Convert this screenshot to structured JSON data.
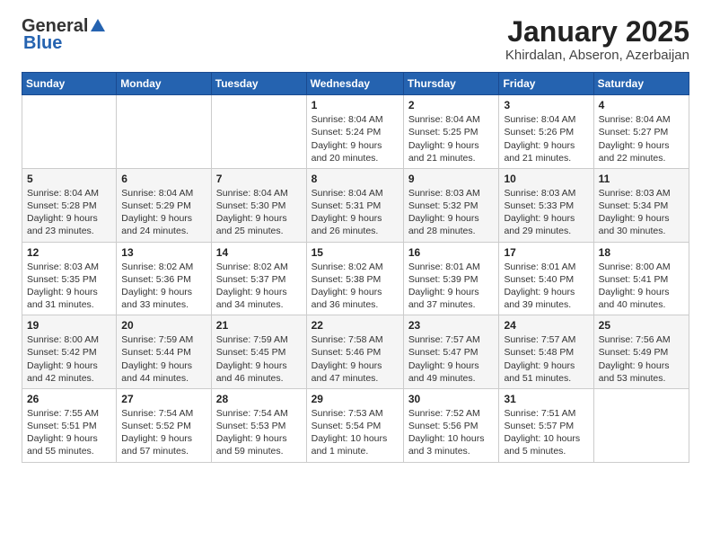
{
  "logo": {
    "line1": "General",
    "line2": "Blue"
  },
  "title": "January 2025",
  "subtitle": "Khirdalan, Abseron, Azerbaijan",
  "days_of_week": [
    "Sunday",
    "Monday",
    "Tuesday",
    "Wednesday",
    "Thursday",
    "Friday",
    "Saturday"
  ],
  "weeks": [
    [
      null,
      null,
      null,
      {
        "day": 1,
        "sunrise": "8:04 AM",
        "sunset": "5:24 PM",
        "daylight": "9 hours and 20 minutes."
      },
      {
        "day": 2,
        "sunrise": "8:04 AM",
        "sunset": "5:25 PM",
        "daylight": "9 hours and 21 minutes."
      },
      {
        "day": 3,
        "sunrise": "8:04 AM",
        "sunset": "5:26 PM",
        "daylight": "9 hours and 21 minutes."
      },
      {
        "day": 4,
        "sunrise": "8:04 AM",
        "sunset": "5:27 PM",
        "daylight": "9 hours and 22 minutes."
      }
    ],
    [
      {
        "day": 5,
        "sunrise": "8:04 AM",
        "sunset": "5:28 PM",
        "daylight": "9 hours and 23 minutes."
      },
      {
        "day": 6,
        "sunrise": "8:04 AM",
        "sunset": "5:29 PM",
        "daylight": "9 hours and 24 minutes."
      },
      {
        "day": 7,
        "sunrise": "8:04 AM",
        "sunset": "5:30 PM",
        "daylight": "9 hours and 25 minutes."
      },
      {
        "day": 8,
        "sunrise": "8:04 AM",
        "sunset": "5:31 PM",
        "daylight": "9 hours and 26 minutes."
      },
      {
        "day": 9,
        "sunrise": "8:03 AM",
        "sunset": "5:32 PM",
        "daylight": "9 hours and 28 minutes."
      },
      {
        "day": 10,
        "sunrise": "8:03 AM",
        "sunset": "5:33 PM",
        "daylight": "9 hours and 29 minutes."
      },
      {
        "day": 11,
        "sunrise": "8:03 AM",
        "sunset": "5:34 PM",
        "daylight": "9 hours and 30 minutes."
      }
    ],
    [
      {
        "day": 12,
        "sunrise": "8:03 AM",
        "sunset": "5:35 PM",
        "daylight": "9 hours and 31 minutes."
      },
      {
        "day": 13,
        "sunrise": "8:02 AM",
        "sunset": "5:36 PM",
        "daylight": "9 hours and 33 minutes."
      },
      {
        "day": 14,
        "sunrise": "8:02 AM",
        "sunset": "5:37 PM",
        "daylight": "9 hours and 34 minutes."
      },
      {
        "day": 15,
        "sunrise": "8:02 AM",
        "sunset": "5:38 PM",
        "daylight": "9 hours and 36 minutes."
      },
      {
        "day": 16,
        "sunrise": "8:01 AM",
        "sunset": "5:39 PM",
        "daylight": "9 hours and 37 minutes."
      },
      {
        "day": 17,
        "sunrise": "8:01 AM",
        "sunset": "5:40 PM",
        "daylight": "9 hours and 39 minutes."
      },
      {
        "day": 18,
        "sunrise": "8:00 AM",
        "sunset": "5:41 PM",
        "daylight": "9 hours and 40 minutes."
      }
    ],
    [
      {
        "day": 19,
        "sunrise": "8:00 AM",
        "sunset": "5:42 PM",
        "daylight": "9 hours and 42 minutes."
      },
      {
        "day": 20,
        "sunrise": "7:59 AM",
        "sunset": "5:44 PM",
        "daylight": "9 hours and 44 minutes."
      },
      {
        "day": 21,
        "sunrise": "7:59 AM",
        "sunset": "5:45 PM",
        "daylight": "9 hours and 46 minutes."
      },
      {
        "day": 22,
        "sunrise": "7:58 AM",
        "sunset": "5:46 PM",
        "daylight": "9 hours and 47 minutes."
      },
      {
        "day": 23,
        "sunrise": "7:57 AM",
        "sunset": "5:47 PM",
        "daylight": "9 hours and 49 minutes."
      },
      {
        "day": 24,
        "sunrise": "7:57 AM",
        "sunset": "5:48 PM",
        "daylight": "9 hours and 51 minutes."
      },
      {
        "day": 25,
        "sunrise": "7:56 AM",
        "sunset": "5:49 PM",
        "daylight": "9 hours and 53 minutes."
      }
    ],
    [
      {
        "day": 26,
        "sunrise": "7:55 AM",
        "sunset": "5:51 PM",
        "daylight": "9 hours and 55 minutes."
      },
      {
        "day": 27,
        "sunrise": "7:54 AM",
        "sunset": "5:52 PM",
        "daylight": "9 hours and 57 minutes."
      },
      {
        "day": 28,
        "sunrise": "7:54 AM",
        "sunset": "5:53 PM",
        "daylight": "9 hours and 59 minutes."
      },
      {
        "day": 29,
        "sunrise": "7:53 AM",
        "sunset": "5:54 PM",
        "daylight": "10 hours and 1 minute."
      },
      {
        "day": 30,
        "sunrise": "7:52 AM",
        "sunset": "5:56 PM",
        "daylight": "10 hours and 3 minutes."
      },
      {
        "day": 31,
        "sunrise": "7:51 AM",
        "sunset": "5:57 PM",
        "daylight": "10 hours and 5 minutes."
      },
      null
    ]
  ]
}
